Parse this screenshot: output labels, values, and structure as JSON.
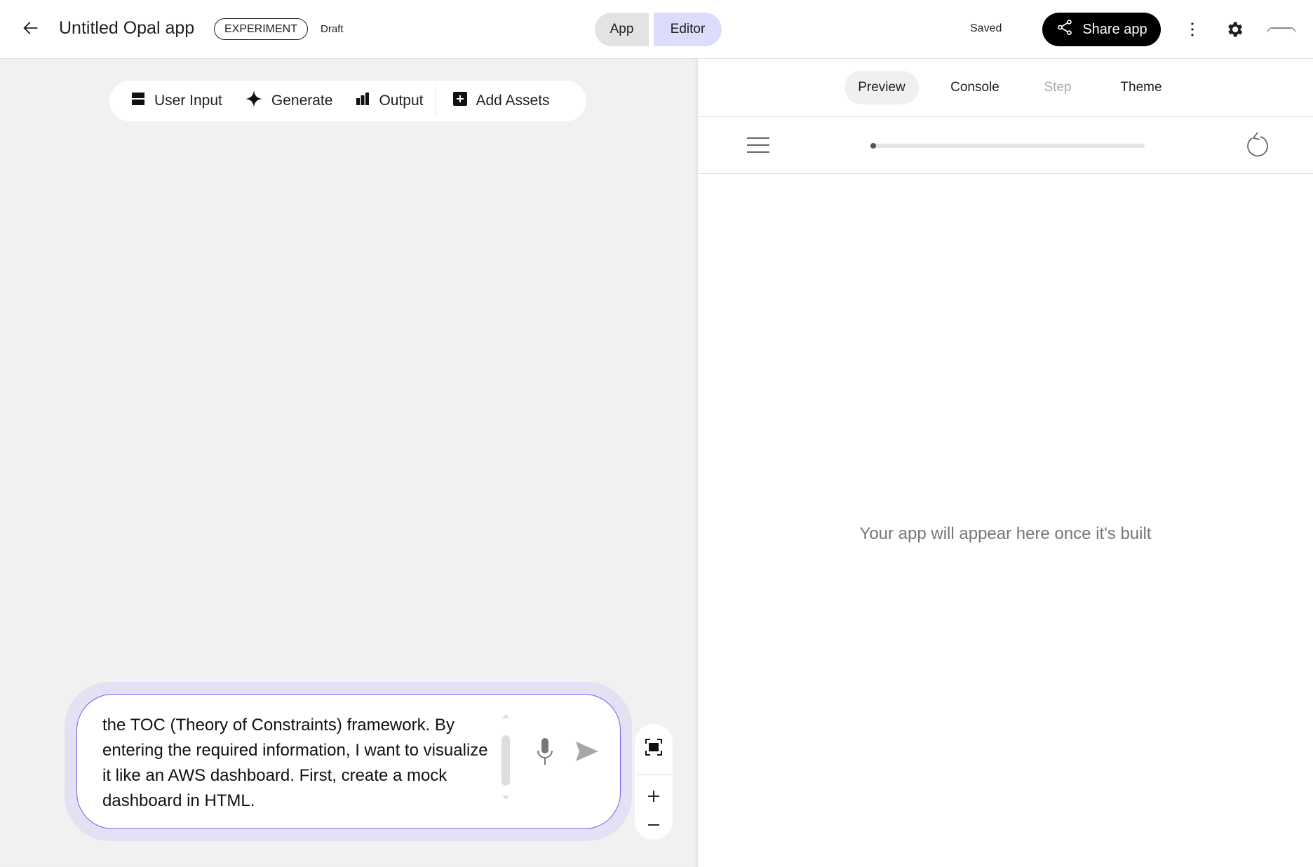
{
  "header": {
    "title": "Untitled Opal app",
    "badge": "EXPERIMENT",
    "status": "Draft",
    "app_tab": "App",
    "editor_tab": "Editor",
    "saved": "Saved",
    "share_label": "Share app",
    "avatar_logo": "logo"
  },
  "toolbar": {
    "user_input": "User Input",
    "generate": "Generate",
    "output": "Output",
    "add_assets": "Add Assets"
  },
  "right": {
    "tabs": [
      "Preview",
      "Console",
      "Step",
      "Theme"
    ],
    "placeholder": "Your app will appear here once it's built",
    "progress": 0
  },
  "prompt": {
    "text": "the TOC (Theory of Constraints) framework. By entering the required information, I want to visualize it like an AWS dashboard. First, create a mock dashboard in HTML."
  },
  "colors": {
    "accent": "#dcdcfc",
    "prompt_border": "#6e63f0",
    "prompt_halo": "#e3e1f3"
  }
}
